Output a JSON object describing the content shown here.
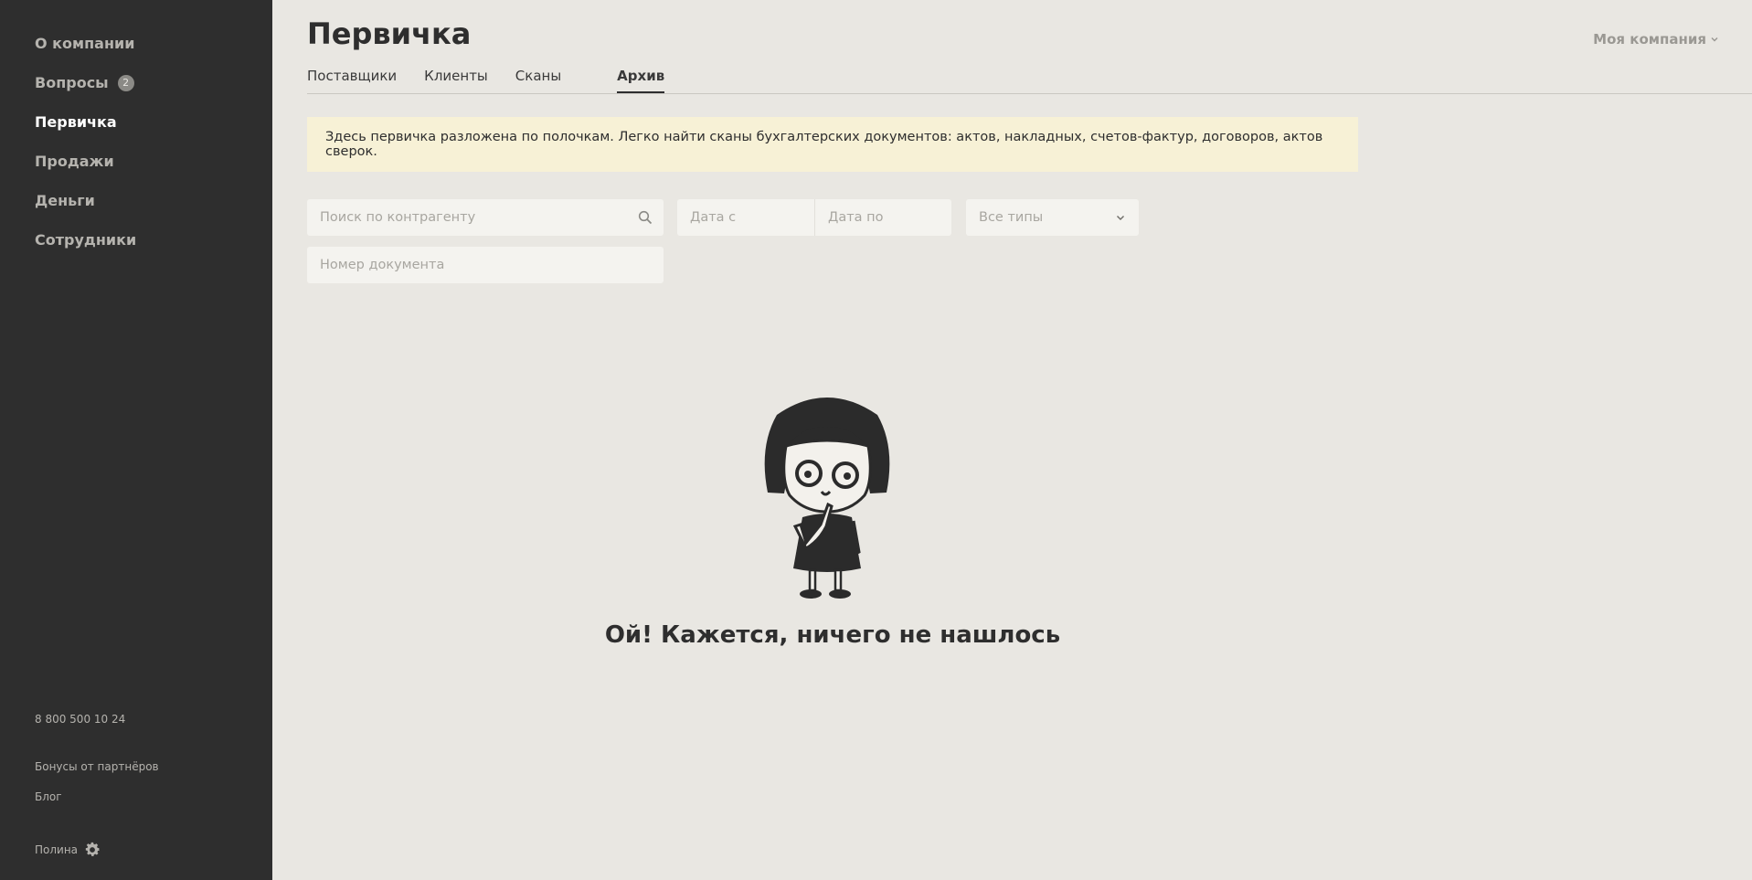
{
  "sidebar": {
    "items": [
      {
        "label": "О компании"
      },
      {
        "label": "Вопросы",
        "badge": "2"
      },
      {
        "label": "Первичка"
      },
      {
        "label": "Продажи"
      },
      {
        "label": "Деньги"
      },
      {
        "label": "Сотрудники"
      }
    ],
    "active_item": "Первичка",
    "phone": "8 800 500 10 24",
    "partners_link": "Бонусы от партнёров",
    "blog_link": "Блог",
    "user_name": "Полина"
  },
  "header": {
    "title": "Первичка",
    "company_menu": "Моя компания"
  },
  "tabs": [
    {
      "label": "Поставщики"
    },
    {
      "label": "Клиенты"
    },
    {
      "label": "Сканы"
    },
    {
      "label": "Архив"
    }
  ],
  "active_tab": "Архив",
  "notice": "Здесь первичка разложена по полочкам. Легко найти сканы бухгалтерских документов: актов, накладных, счетов-фактур, договоров, актов сверок.",
  "filters": {
    "search_placeholder": "Поиск по контрагенту",
    "date_from_placeholder": "Дата с",
    "date_to_placeholder": "Дата по",
    "type_select": "Все типы",
    "doc_number_placeholder": "Номер документа"
  },
  "empty_state": {
    "message": "Ой! Кажется, ничего не нашлось"
  },
  "colors": {
    "sidebar_bg": "#2e2e2e",
    "page_bg": "#e9e7e2",
    "notice_bg": "#f7f1d6",
    "field_bg": "#f4f3ef"
  }
}
